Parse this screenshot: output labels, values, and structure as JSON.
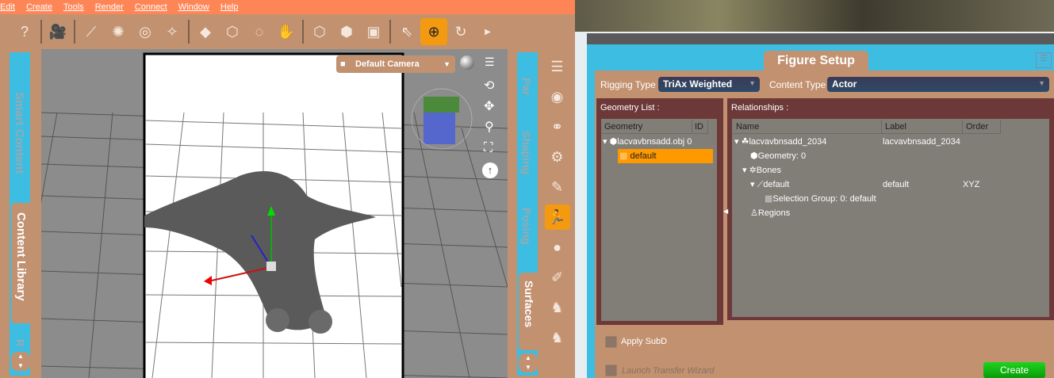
{
  "menu": [
    "Edit",
    "Create",
    "Tools",
    "Render",
    "Connect",
    "Window",
    "Help"
  ],
  "left_panel": {
    "tabs": [
      "Smart Content",
      "Content Library",
      "R"
    ]
  },
  "viewport": {
    "camera": "Default Camera"
  },
  "right_tabs": [
    "Par",
    "Shaping",
    "Posing",
    "Surfaces"
  ],
  "figure_setup": {
    "title": "Figure Setup",
    "rigging_label": "Rigging Type :",
    "rigging_value": "TriAx Weighted",
    "content_label": "Content Type :",
    "content_value": "Actor",
    "geometry_list": {
      "label": "Geometry List :",
      "columns": [
        "Geometry",
        "ID"
      ],
      "rows": [
        {
          "name": "lacvavbnsadd.obj",
          "id": "0"
        },
        {
          "name": "default",
          "id": ""
        }
      ]
    },
    "relationships": {
      "label": "Relationships :",
      "columns": [
        "Name",
        "Label",
        "Order"
      ],
      "rows": [
        {
          "name": "lacvavbnsadd_2034",
          "label": "lacvavbnsadd_2034",
          "order": ""
        },
        {
          "name": "Geometry: 0",
          "label": "",
          "order": ""
        },
        {
          "name": "Bones",
          "label": "",
          "order": ""
        },
        {
          "name": "default",
          "label": "default",
          "order": "XYZ"
        },
        {
          "name": "Selection Group: 0: default",
          "label": "",
          "order": ""
        },
        {
          "name": "Regions",
          "label": "",
          "order": ""
        }
      ]
    },
    "apply_subd": "Apply SubD",
    "launch_transfer": "Launch Transfer Wizard",
    "create": "Create"
  },
  "colors": {
    "menubar": "#fe8656",
    "panel": "#c29170",
    "tab_blue": "#3dbde2",
    "active": "#f39a10",
    "list_box": "#6d3838",
    "selection": "#ff9900",
    "create": "#12b812"
  }
}
